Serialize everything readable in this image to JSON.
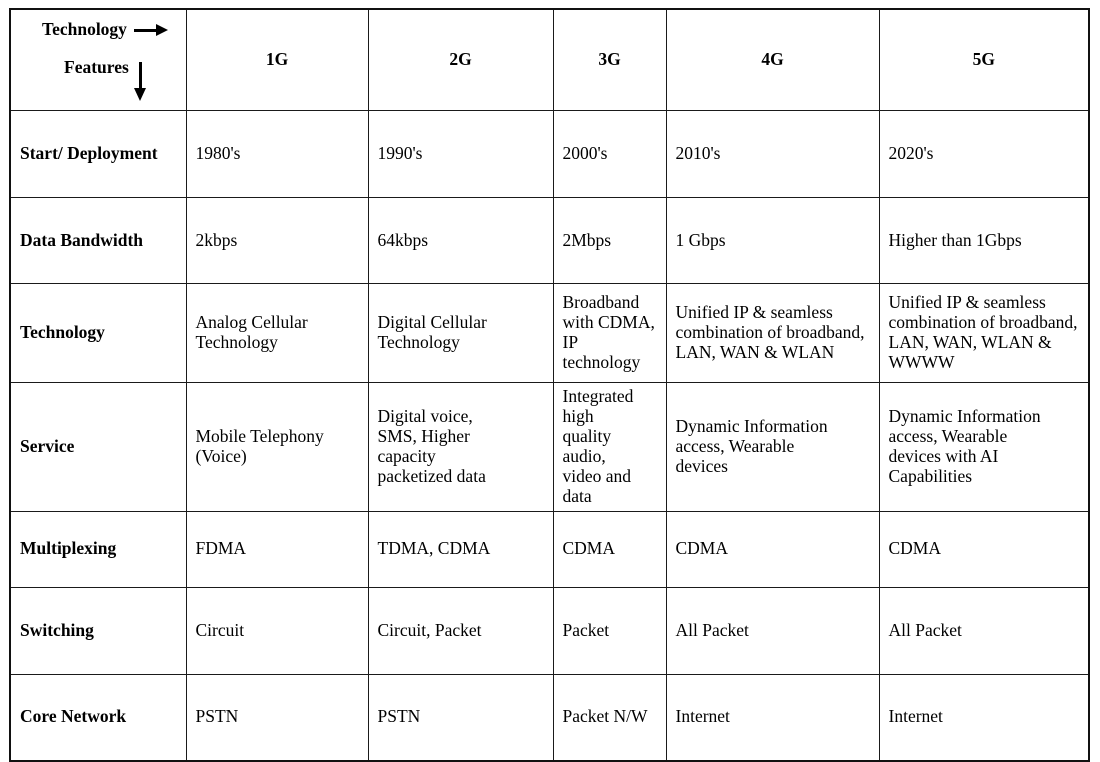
{
  "table": {
    "corner": {
      "technology_label": "Technology",
      "features_label": "Features",
      "right_arrow_icon": "arrow-right-icon",
      "down_arrow_icon": "arrow-down-icon"
    },
    "columns": [
      "1G",
      "2G",
      "3G",
      "4G",
      "5G"
    ],
    "rows": [
      {
        "feature": "Start/ Deployment",
        "values": [
          "1980's",
          "1990's",
          "2000's",
          "2010's",
          "2020's"
        ]
      },
      {
        "feature": "Data Bandwidth",
        "values": [
          "2kbps",
          "64kbps",
          "2Mbps",
          "1 Gbps",
          "Higher than 1Gbps"
        ]
      },
      {
        "feature": "Technology",
        "values": [
          "Analog Cellular\nTechnology",
          "Digital Cellular\nTechnology",
          "Broadband\nwith CDMA,\nIP\ntechnology",
          "Unified IP & seamless\ncombination of broadband,\nLAN, WAN & WLAN",
          "Unified IP & seamless\ncombination of broadband,\nLAN, WAN, WLAN &\nWWWW"
        ]
      },
      {
        "feature": "Service",
        "values": [
          "Mobile Telephony\n(Voice)",
          "Digital voice,\nSMS, Higher\ncapacity\npacketized data",
          "Integrated high\nquality audio,\nvideo and data",
          "Dynamic Information\naccess, Wearable\ndevices",
          "Dynamic Information\naccess, Wearable\ndevices with AI\nCapabilities"
        ]
      },
      {
        "feature": "Multiplexing",
        "values": [
          "FDMA",
          "TDMA, CDMA",
          "CDMA",
          "CDMA",
          "CDMA"
        ]
      },
      {
        "feature": "Switching",
        "values": [
          "Circuit",
          "Circuit, Packet",
          "Packet",
          "All Packet",
          "All Packet"
        ]
      },
      {
        "feature": "Core Network",
        "values": [
          "PSTN",
          "PSTN",
          "Packet N/W",
          "Internet",
          "Internet"
        ]
      }
    ]
  },
  "style": {
    "border_color": "#1a1a1a",
    "text_color": "#000000",
    "background_color": "#ffffff"
  }
}
